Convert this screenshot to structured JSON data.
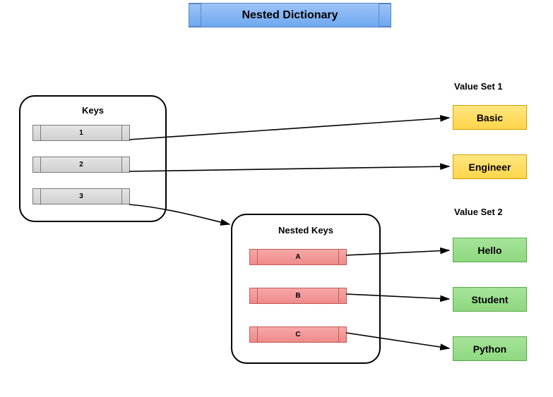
{
  "title": "Nested Dictionary",
  "keys": {
    "frame_title": "Keys",
    "items": [
      "1",
      "2",
      "3"
    ]
  },
  "nested_keys": {
    "frame_title": "Nested Keys",
    "items": [
      "A",
      "B",
      "C"
    ]
  },
  "value_set_1": {
    "label": "Value Set 1",
    "items": [
      "Basic",
      "Engineer"
    ]
  },
  "value_set_2": {
    "label": "Value Set 2",
    "items": [
      "Hello",
      "Student",
      "Python"
    ]
  }
}
